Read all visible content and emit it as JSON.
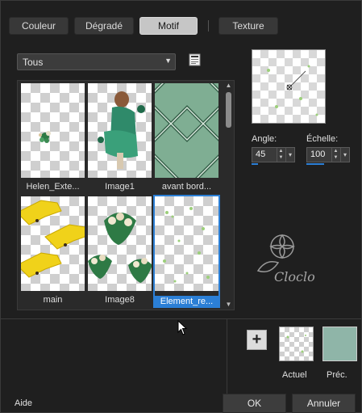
{
  "tabs": [
    {
      "label": "Couleur"
    },
    {
      "label": "Dégradé"
    },
    {
      "label": "Motif"
    },
    {
      "label": "Texture"
    }
  ],
  "active_tab": "Motif",
  "category": {
    "selected": "Tous"
  },
  "thumbnails": [
    {
      "label": "Helen_Exte...",
      "selected": false
    },
    {
      "label": "Image1",
      "selected": false
    },
    {
      "label": "avant bord...",
      "selected": false
    },
    {
      "label": "main",
      "selected": false
    },
    {
      "label": "Image8",
      "selected": false
    },
    {
      "label": "Element_re...",
      "selected": true
    }
  ],
  "angle": {
    "label": "Angle:",
    "value": "45"
  },
  "scale": {
    "label": "Échelle:",
    "value": "100"
  },
  "swatches": {
    "current_label": "Actuel",
    "previous_label": "Préc.",
    "previous_color": "#8fb5a8"
  },
  "add_button_label": "+",
  "watermark_text": "Cloclo",
  "footer": {
    "help": "Aide",
    "ok": "OK",
    "cancel": "Annuler"
  },
  "icons": {
    "browse": "browse-folder-icon",
    "dropdown": "chevron-down-icon"
  },
  "colors": {
    "accent": "#2b7fd6",
    "background": "#1f1f1f"
  }
}
